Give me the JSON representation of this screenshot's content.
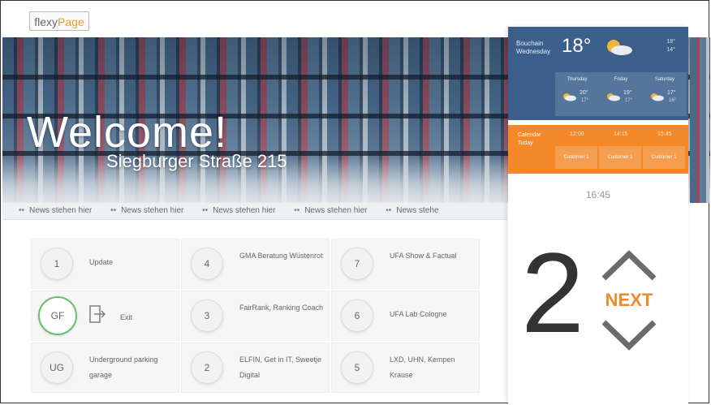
{
  "logo": {
    "part1": "flexy",
    "part2": "Page"
  },
  "hero": {
    "welcome": "Welcome!",
    "address": "Siegburger Straße 215"
  },
  "ticker": {
    "items": [
      "News stehen hier",
      "News stehen hier",
      "News stehen hier",
      "News stehen hier",
      "News stehe"
    ]
  },
  "rooms": [
    {
      "badge": "1",
      "label": "Update"
    },
    {
      "badge": "4",
      "label": "GMA Beratung Wüstenrot"
    },
    {
      "badge": "7",
      "label": "UFA Show & Factual"
    },
    {
      "badge": "GF",
      "label": "Exit"
    },
    {
      "badge": "3",
      "label": "FairRank, Ranking Coach"
    },
    {
      "badge": "6",
      "label": "UFA Lab Cologne"
    },
    {
      "badge": "UG",
      "label": "Underground parking garage"
    },
    {
      "badge": "2",
      "label": "ELFIN, Get in IT, Sweetje Digital"
    },
    {
      "badge": "5",
      "label": "LXD, UHN, Kempen Krause"
    }
  ],
  "weather": {
    "city": "Bouchain",
    "day": "Wednesday",
    "temp": "18°",
    "hi": "18°",
    "lo": "14°",
    "forecast": [
      {
        "day": "Thursday",
        "hi": "20°",
        "lo": "17°"
      },
      {
        "day": "Friday",
        "hi": "19°",
        "lo": "17°"
      },
      {
        "day": "Saturday",
        "hi": "17°",
        "lo": "16°"
      }
    ]
  },
  "calendar": {
    "title": "Calendar",
    "subtitle": "Today",
    "times": [
      "12:00",
      "14:15",
      "15:45"
    ],
    "entries": [
      "Customer 1",
      "Customer 1",
      "Customer 1"
    ]
  },
  "clock": "16:45",
  "floor": {
    "number": "2",
    "next_label": "NEXT"
  },
  "colors": {
    "accent": "#f08a2b",
    "calendar": "#f5892a",
    "weather": "#3b5f8a",
    "ground_ring": "#6cbf6c"
  }
}
